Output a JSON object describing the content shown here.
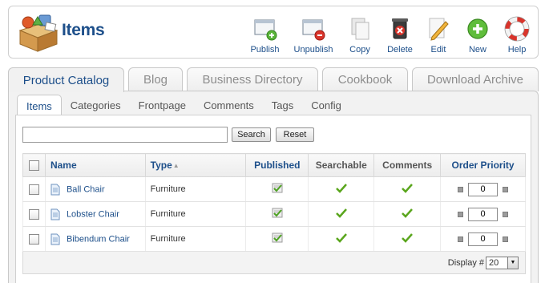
{
  "page_title": "Items",
  "toolbar": {
    "buttons": [
      {
        "id": "publish",
        "label": "Publish",
        "icon": "publish-icon"
      },
      {
        "id": "unpublish",
        "label": "Unpublish",
        "icon": "unpublish-icon"
      },
      {
        "id": "copy",
        "label": "Copy",
        "icon": "copy-icon"
      },
      {
        "id": "delete",
        "label": "Delete",
        "icon": "delete-icon"
      },
      {
        "id": "edit",
        "label": "Edit",
        "icon": "edit-icon"
      },
      {
        "id": "new",
        "label": "New",
        "icon": "new-icon"
      },
      {
        "id": "help",
        "label": "Help",
        "icon": "help-icon"
      }
    ]
  },
  "main_tabs": [
    "Product Catalog",
    "Blog",
    "Business Directory",
    "Cookbook",
    "Download Archive"
  ],
  "active_main_tab": "Product Catalog",
  "sub_tabs": [
    "Items",
    "Categories",
    "Frontpage",
    "Comments",
    "Tags",
    "Config"
  ],
  "active_sub_tab": "Items",
  "search": {
    "value": "",
    "search_label": "Search",
    "reset_label": "Reset"
  },
  "table": {
    "headers": {
      "name": "Name",
      "type": "Type",
      "published": "Published",
      "searchable": "Searchable",
      "comments": "Comments",
      "order_priority": "Order Priority"
    },
    "sort_indicator": "▲",
    "rows": [
      {
        "name": "Ball Chair",
        "type": "Furniture",
        "published": true,
        "searchable": true,
        "comments": true,
        "order": "0"
      },
      {
        "name": "Lobster Chair",
        "type": "Furniture",
        "published": true,
        "searchable": true,
        "comments": true,
        "order": "0"
      },
      {
        "name": "Bibendum Chair",
        "type": "Furniture",
        "published": true,
        "searchable": true,
        "comments": true,
        "order": "0"
      }
    ]
  },
  "footer": {
    "display_label": "Display #",
    "display_value": "20"
  },
  "colors": {
    "accent": "#1d4f8a",
    "check_green": "#5aa61d"
  }
}
